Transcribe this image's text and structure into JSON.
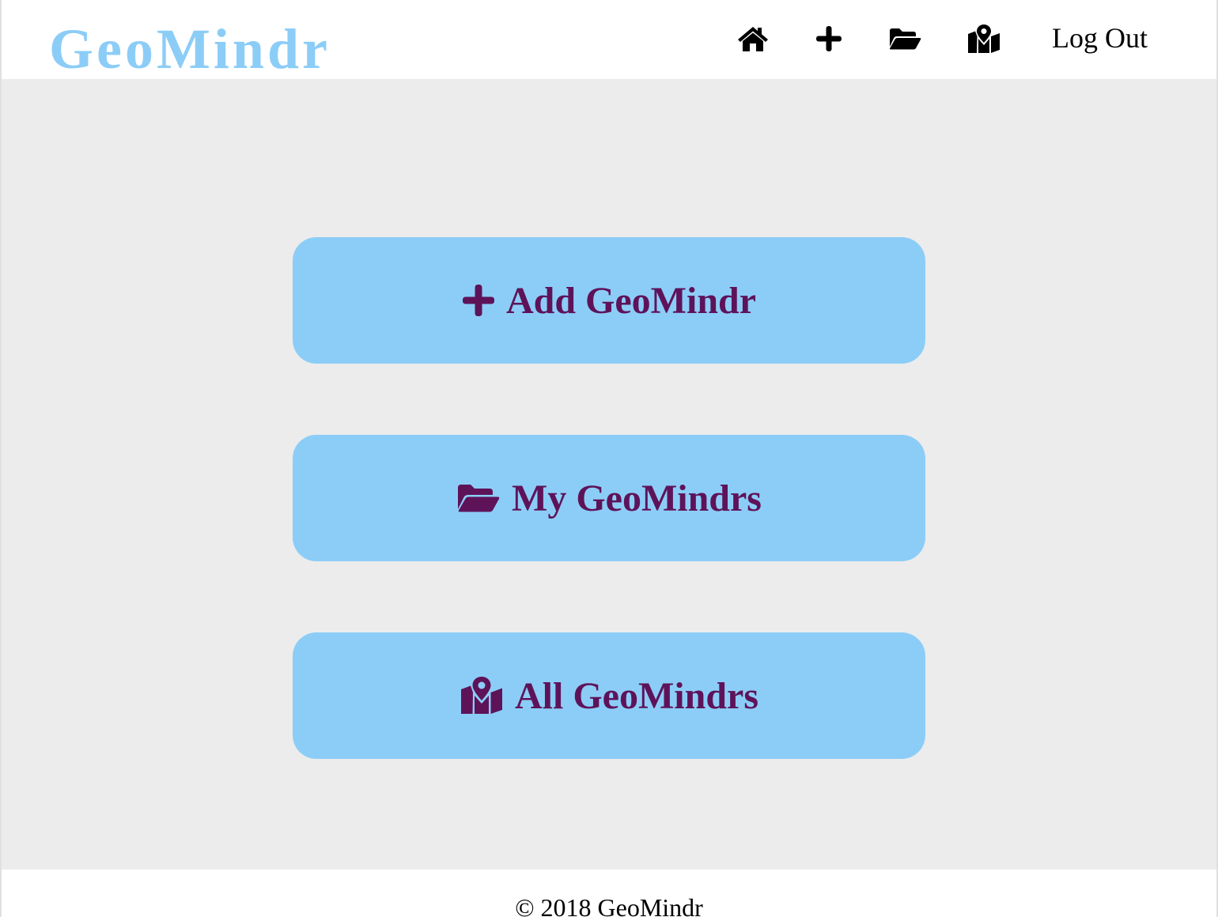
{
  "header": {
    "logo": "GeoMindr",
    "logout_label": "Log Out",
    "nav_icons": [
      "home-icon",
      "plus-icon",
      "folder-open-icon",
      "map-marked-icon"
    ]
  },
  "main": {
    "buttons": [
      {
        "label": "Add GeoMindr",
        "icon": "plus-icon"
      },
      {
        "label": "My GeoMindrs",
        "icon": "folder-open-icon"
      },
      {
        "label": "All GeoMindrs",
        "icon": "map-marked-icon"
      }
    ]
  },
  "footer": {
    "copyright": "© 2018 GeoMindr"
  },
  "colors": {
    "brand": "#8ccdf7",
    "button_bg": "#8ccdf7",
    "button_text": "#5e1359",
    "main_bg": "#ececec"
  }
}
